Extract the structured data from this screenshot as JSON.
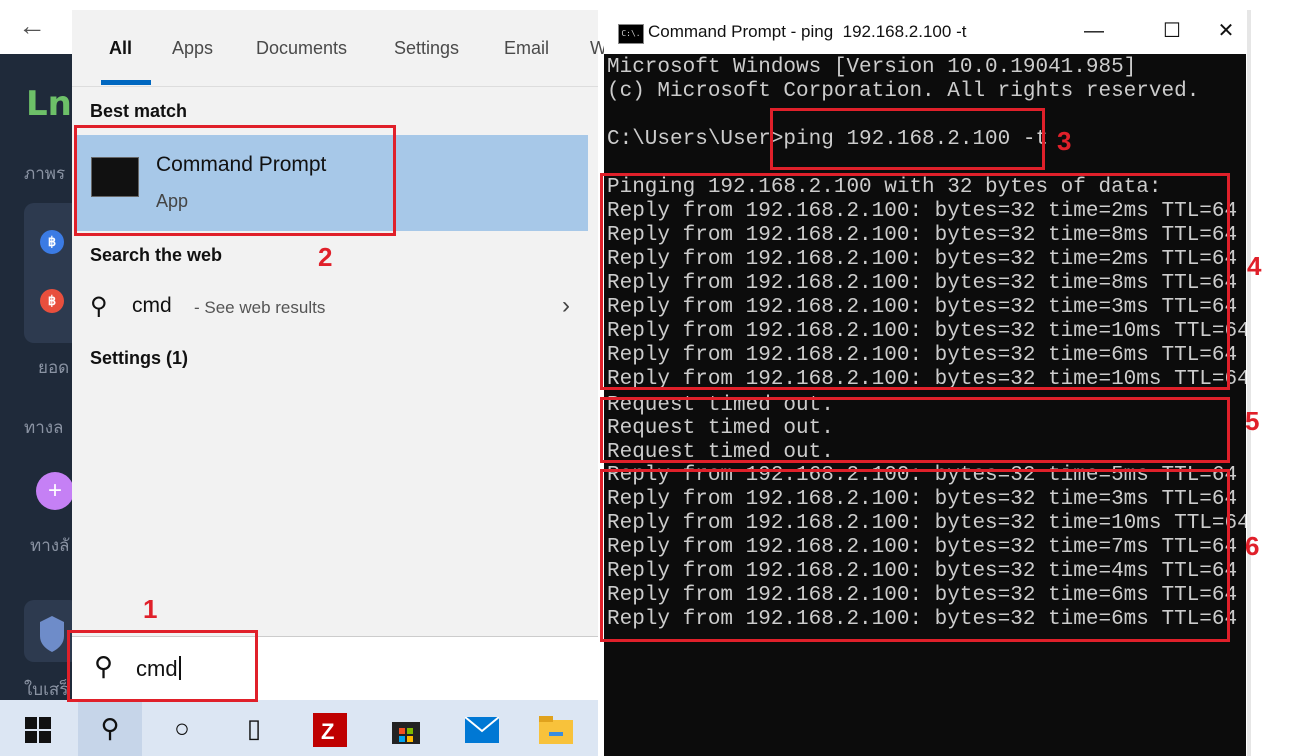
{
  "background_app": {
    "logo": "Ln",
    "labels": [
      "ภาพร",
      "ยอด",
      "ทางล",
      "ทางลั",
      "ใบเสร็"
    ],
    "coin_symbol": "฿"
  },
  "search_panel": {
    "tabs": [
      "All",
      "Apps",
      "Documents",
      "Settings",
      "Email",
      "W"
    ],
    "best_match_title": "Best match",
    "best_match": {
      "name": "Command Prompt",
      "type": "App"
    },
    "search_web_title": "Search the web",
    "web_result": {
      "query": "cmd",
      "hint": "- See web results"
    },
    "settings_label": "Settings (1)",
    "search_box_value": "cmd"
  },
  "taskbar": {
    "items": [
      "start-icon",
      "search-icon",
      "cortana-icon",
      "task-view-icon",
      "filezilla-icon",
      "store-icon",
      "mail-icon",
      "file-explorer-icon"
    ]
  },
  "cmd_window": {
    "title": "Command Prompt - ping  192.168.2.100 -t",
    "app_icon_text": "C:\\.",
    "buttons": {
      "minimize": "—",
      "maximize": "☐",
      "close": "✕"
    },
    "lines": [
      "Microsoft Windows [Version 10.0.19041.985]",
      "(c) Microsoft Corporation. All rights reserved.",
      "",
      "C:\\Users\\User>ping 192.168.2.100 -t",
      "",
      "Pinging 192.168.2.100 with 32 bytes of data:",
      "Reply from 192.168.2.100: bytes=32 time=2ms TTL=64",
      "Reply from 192.168.2.100: bytes=32 time=8ms TTL=64",
      "Reply from 192.168.2.100: bytes=32 time=2ms TTL=64",
      "Reply from 192.168.2.100: bytes=32 time=8ms TTL=64",
      "Reply from 192.168.2.100: bytes=32 time=3ms TTL=64",
      "Reply from 192.168.2.100: bytes=32 time=10ms TTL=64",
      "Reply from 192.168.2.100: bytes=32 time=6ms TTL=64",
      "Reply from 192.168.2.100: bytes=32 time=10ms TTL=64",
      "Request timed out.",
      "Request timed out.",
      "Request timed out.",
      "Reply from 192.168.2.100: bytes=32 time=5ms TTL=64",
      "Reply from 192.168.2.100: bytes=32 time=3ms TTL=64",
      "Reply from 192.168.2.100: bytes=32 time=10ms TTL=64",
      "Reply from 192.168.2.100: bytes=32 time=7ms TTL=64",
      "Reply from 192.168.2.100: bytes=32 time=4ms TTL=64",
      "Reply from 192.168.2.100: bytes=32 time=6ms TTL=64",
      "Reply from 192.168.2.100: bytes=32 time=6ms TTL=64"
    ]
  },
  "annotations": [
    "1",
    "2",
    "3",
    "4",
    "5",
    "6"
  ],
  "colors": {
    "annotation": "#e0202a",
    "accent": "#0067c0",
    "selection": "#a7c8e8"
  }
}
